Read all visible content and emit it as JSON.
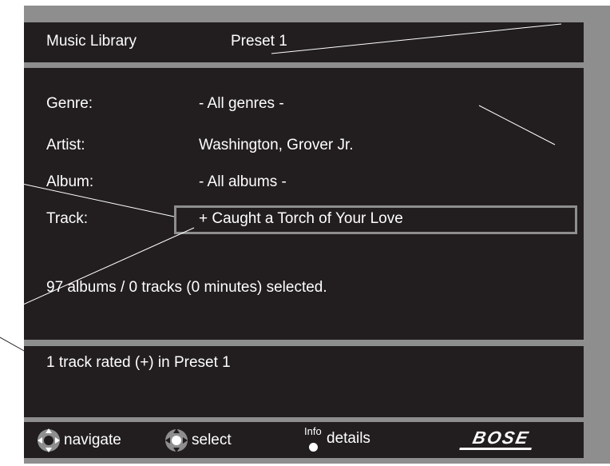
{
  "header": {
    "app_title": "Music Library",
    "preset": "Preset 1"
  },
  "rows": [
    {
      "label": "Genre:",
      "value": "- All genres -"
    },
    {
      "label": "Artist:",
      "value": "Washington, Grover Jr."
    },
    {
      "label": "Album:",
      "value": "- All albums -"
    },
    {
      "label": "Track:",
      "value": "+ Caught a Torch of Your Love"
    }
  ],
  "status": "97 albums / 0 tracks (0 minutes) selected.",
  "message": "1 track rated (+) in Preset 1",
  "footer": {
    "navigate": "navigate",
    "select": "select",
    "info_sup": "Info",
    "details": "details",
    "brand": "BOSE"
  },
  "icons": {
    "navigate": "dpad-icon",
    "select": "dpad-select-icon",
    "info": "info-button-icon"
  },
  "colors": {
    "panel": "#221e1f",
    "bezel": "#8e8e8e",
    "text": "#ffffff"
  }
}
